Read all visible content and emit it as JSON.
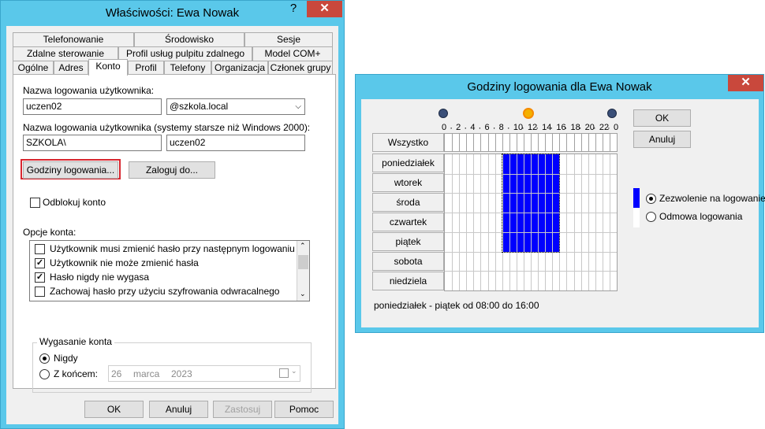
{
  "dialog1": {
    "title": "Właściwości: Ewa Nowak",
    "title_buttons": {
      "help": "?",
      "close": "✕"
    },
    "tabs_row1": [
      "Telefonowanie",
      "Środowisko",
      "Sesje"
    ],
    "tabs_row2": [
      "Zdalne sterowanie",
      "Profil usług pulpitu zdalnego",
      "Model COM+"
    ],
    "tabs_row3": [
      "Ogólne",
      "Adres",
      "Konto",
      "Profil",
      "Telefony",
      "Organizacja",
      "Członek grupy"
    ],
    "logon_name_label": "Nazwa logowania użytkownika:",
    "logon_name_value": "uczen02",
    "domain_value": "@szkola.local",
    "legacy_label": "Nazwa logowania użytkownika (systemy starsze niż Windows 2000):",
    "legacy_domain": "SZKOLA\\",
    "legacy_name": "uczen02",
    "logon_hours_button": "Godziny logowania...",
    "logon_to_button": "Zaloguj do...",
    "unlock_label": "Odblokuj konto",
    "account_options_label": "Opcje konta:",
    "account_options": [
      {
        "label": "Użytkownik musi zmienić hasło przy następnym logowaniu",
        "checked": false
      },
      {
        "label": "Użytkownik nie może zmienić hasła",
        "checked": true
      },
      {
        "label": "Hasło nigdy nie wygasa",
        "checked": true
      },
      {
        "label": "Zachowaj hasło przy użyciu szyfrowania odwracalnego",
        "checked": false
      }
    ],
    "expiry_group": "Wygasanie konta",
    "expiry_never": "Nigdy",
    "expiry_end": "Z końcem:",
    "expiry_date": {
      "day": "26",
      "month": "marca",
      "year": "2023"
    },
    "buttons": {
      "ok": "OK",
      "cancel": "Anuluj",
      "apply": "Zastosuj",
      "help": "Pomoc"
    },
    "highlight_color": "#d8262f"
  },
  "dialog2": {
    "title": "Godziny logowania dla Ewa Nowak",
    "close": "✕",
    "hour_labels": [
      "0",
      "2",
      "4",
      "6",
      "8",
      "10",
      "12",
      "14",
      "16",
      "18",
      "20",
      "22",
      "0"
    ],
    "all_button": "Wszystko",
    "days": [
      "poniedziałek",
      "wtorek",
      "środa",
      "czwartek",
      "piątek",
      "sobota",
      "niedziela"
    ],
    "allowed": {
      "days": [
        "poniedziałek",
        "wtorek",
        "środa",
        "czwartek",
        "piątek"
      ],
      "from_hour": 8,
      "to_hour": 16
    },
    "ok": "OK",
    "cancel": "Anuluj",
    "permit_label": "Zezwolenie na logowanie",
    "deny_label": "Odmowa logowania",
    "status": "poniedziałek - piątek od 08:00 do 16:00",
    "allowed_color": "#0000ff",
    "icons": [
      "moon-icon",
      "sun-icon",
      "moon-icon"
    ]
  }
}
